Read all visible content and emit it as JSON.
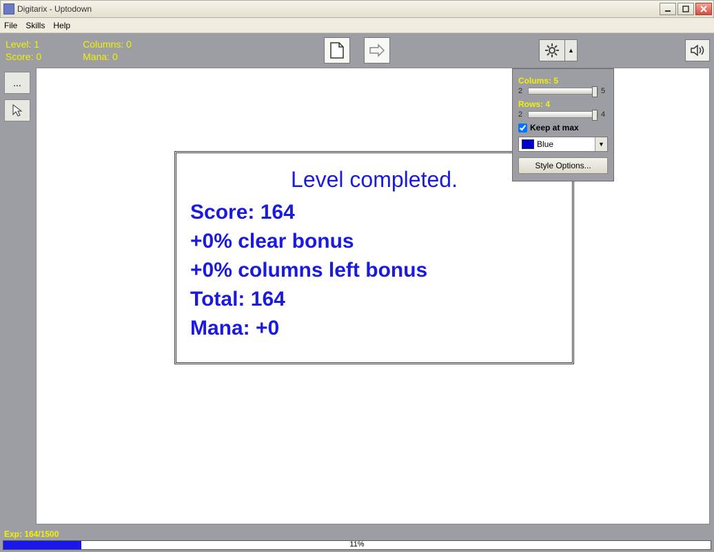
{
  "window": {
    "title": "Digitarix - Uptodown"
  },
  "menu": {
    "file": "File",
    "skills": "Skills",
    "help": "Help"
  },
  "stats": {
    "level_label": "Level: 1",
    "score_label": "Score: 0",
    "columns_label": "Columns: 0",
    "mana_label": "Mana: 0"
  },
  "result": {
    "title": "Level completed.",
    "score": "Score: 164",
    "clear_bonus": "+0% clear bonus",
    "columns_bonus": "+0% columns left bonus",
    "total": "Total: 164",
    "mana": "Mana: +0"
  },
  "settings": {
    "columns_label": "Colums: 5",
    "columns_min": "2",
    "columns_max": "5",
    "rows_label": "Rows: 4",
    "rows_min": "2",
    "rows_max": "4",
    "keep_max_label": "Keep at max",
    "color_name": "Blue",
    "style_button": "Style Options..."
  },
  "bottom": {
    "exp_label": "Exp: 164/1500",
    "percent": "11%"
  },
  "tool_ellipsis": "..."
}
